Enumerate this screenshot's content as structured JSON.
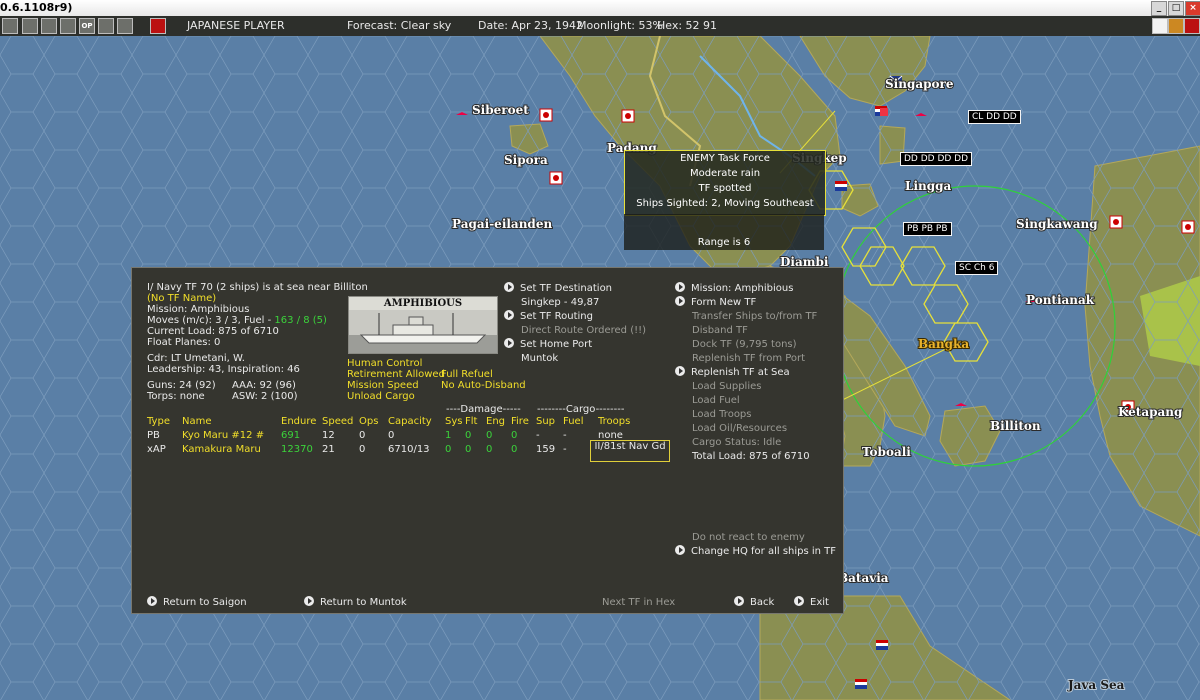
{
  "window": {
    "title": "0.6.1108r9)"
  },
  "toolbar": {
    "player": "JAPANESE PLAYER",
    "forecast": "Forecast: Clear sky",
    "date": "Date: Apr 23, 1942",
    "moonlight": "Moonlight: 53%",
    "hex": "Hex: 52 91",
    "button_labels": [
      "OP"
    ]
  },
  "map": {
    "labels": [
      "Siberoet",
      "Sipora",
      "Padang",
      "Pagai-eilanden",
      "Singapore",
      "Lingga",
      "Singkep",
      "Diambi",
      "Singkawang",
      "Pontianak",
      "Bangka",
      "Billiton",
      "Toboali",
      "Ketapang",
      "Java Sea",
      "Batavia"
    ],
    "tooltip": {
      "lines": [
        "ENEMY Task Force",
        "Moderate rain",
        "TF spotted",
        "Ships Sighted: 2, Moving Southeast"
      ],
      "range": "Range is 6"
    },
    "flag_labels": [
      "CL DD DD",
      "DD DD DD DD",
      "PB PB PB",
      "SC Ch 6"
    ],
    "colors": {
      "sea": "#5a7fa6",
      "land": "#8a8f52",
      "highlight": "#e6e03a",
      "range_circle": "#2fd13a"
    }
  },
  "panel": {
    "header": "I/ Navy TF 70 (2 ships) is at sea near Billiton",
    "tf_name": "(No TF Name)",
    "mission": "Mission: Amphibious",
    "moves_prefix": "Moves (m/c): 3 / 3, Fuel - ",
    "moves_fuel": "163 / 8 (5)",
    "current_load": "Current Load: 875 of 6710",
    "float_planes": "Float Planes: 0",
    "commander": "Cdr: LT  Umetani, W.",
    "leadership": "Leadership: 43, Inspiration: 46",
    "guns": "Guns: 24 (92)",
    "aaa": "AAA: 92 (96)",
    "torps": "Torps: none",
    "asw": "ASW: 2 (100)",
    "ship_image_caption": "AMPHIBIOUS",
    "options_left": [
      "Human Control",
      "Retirement Allowed",
      "Mission Speed",
      "Unload Cargo"
    ],
    "options_right": [
      "Full Refuel",
      "No Auto-Disband"
    ],
    "mid_actions": {
      "set_destination": "Set TF Destination",
      "destination_value": "Singkep - 49,87",
      "set_routing": "Set TF Routing",
      "routing_value": "Direct Route Ordered (!!)",
      "set_home": "Set Home Port",
      "home_value": "Muntok"
    },
    "right_actions": [
      {
        "label": "Mission: Amphibious",
        "enabled": true,
        "arrow": true
      },
      {
        "label": "Form New TF",
        "enabled": true,
        "arrow": true
      },
      {
        "label": "Transfer Ships to/from TF",
        "enabled": false,
        "arrow": false
      },
      {
        "label": "Disband TF",
        "enabled": false,
        "arrow": false
      },
      {
        "label": "Dock TF (9,795 tons)",
        "enabled": false,
        "arrow": false
      },
      {
        "label": "Replenish TF from Port",
        "enabled": false,
        "arrow": false
      },
      {
        "label": "Replenish TF at Sea",
        "enabled": true,
        "arrow": true
      },
      {
        "label": "Load Supplies",
        "enabled": false,
        "arrow": false
      },
      {
        "label": "Load Fuel",
        "enabled": false,
        "arrow": false
      },
      {
        "label": "Load Troops",
        "enabled": false,
        "arrow": false
      },
      {
        "label": "Load Oil/Resources",
        "enabled": false,
        "arrow": false
      },
      {
        "label": "Cargo Status: Idle",
        "enabled": false,
        "arrow": false
      },
      {
        "label": "Total Load: 875 of 6710",
        "enabled": true,
        "arrow": false
      }
    ],
    "react_option": "Do not react to enemy",
    "change_hq": "Change HQ for all ships in TF",
    "table": {
      "damage_header": "----Damage-----",
      "cargo_header": "--------Cargo--------",
      "columns": [
        "Type",
        "Name",
        "Endure",
        "Speed",
        "Ops",
        "Capacity",
        "Sys",
        "Flt",
        "Eng",
        "Fire",
        "Sup",
        "Fuel",
        "Troops"
      ],
      "rows": [
        {
          "type": "PB",
          "name": "Kyo Maru #12 #",
          "endure": "691",
          "speed": "12",
          "ops": "0",
          "capacity": "0",
          "sys": "1",
          "flt": "0",
          "eng": "0",
          "fire": "0",
          "sup": "-",
          "fuel": "-",
          "troops": "none"
        },
        {
          "type": "xAP",
          "name": "Kamakura Maru",
          "endure": "12370",
          "speed": "21",
          "ops": "0",
          "capacity": "6710/13",
          "sys": "0",
          "flt": "0",
          "eng": "0",
          "fire": "0",
          "sup": "159",
          "fuel": "-",
          "troops": "II/81st Nav Gd"
        }
      ]
    },
    "bottom": {
      "return_saigon": "Return to Saigon",
      "return_muntok": "Return to Muntok",
      "next_tf": "Next TF in Hex",
      "back": "Back",
      "exit": "Exit"
    }
  }
}
